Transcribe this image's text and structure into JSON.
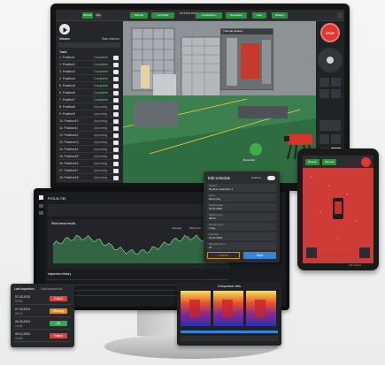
{
  "monitor": {
    "window_title": "ANYmal Monitor",
    "top_buttons": [
      "Mission",
      "Site",
      "Manual",
      "Controller",
      "Localization",
      "Navigation",
      "Map",
      "Battery"
    ],
    "mission_title": "Mission",
    "mission_subtitle": "Start mission",
    "tasks_header": "Tasks",
    "tasks": [
      {
        "name": "1. Position1",
        "status": "Completed"
      },
      {
        "name": "2. Position2",
        "status": "Completed"
      },
      {
        "name": "3. Position3",
        "status": "Completed"
      },
      {
        "name": "4. Position4",
        "status": "Completed"
      },
      {
        "name": "5. Position5",
        "status": "Completed"
      },
      {
        "name": "6. Position6",
        "status": "Completed"
      },
      {
        "name": "7. Position7",
        "status": "Completed"
      },
      {
        "name": "8. Position8",
        "status": "Upcoming"
      },
      {
        "name": "9. Position9",
        "status": "Upcoming"
      },
      {
        "name": "10. Position10",
        "status": "Upcoming"
      },
      {
        "name": "11. Position11",
        "status": "Upcoming"
      },
      {
        "name": "12. Position12",
        "status": "Upcoming"
      },
      {
        "name": "13. Position13",
        "status": "Upcoming"
      },
      {
        "name": "14. Position14",
        "status": "Upcoming"
      },
      {
        "name": "15. Position15",
        "status": "Upcoming"
      },
      {
        "name": "16. Position16",
        "status": "Upcoming"
      },
      {
        "name": "17. Position17",
        "status": "Upcoming"
      },
      {
        "name": "18. Position18",
        "status": "Upcoming"
      }
    ],
    "camera_label": "Thermal camera",
    "scene_label": "Recorded",
    "stop_label": "STOP"
  },
  "laptop": {
    "title": "PCS-N-735",
    "chart_title": "Wind trend results",
    "history_title": "Inspection history",
    "legend": [
      "Average",
      "Maximum",
      "Minimum"
    ]
  },
  "schedule": {
    "title": "Edit schedule",
    "toggle_label": "Enabled",
    "fields": [
      {
        "label": "Mission",
        "value": "Routine inspection 1"
      },
      {
        "label": "Name",
        "value": "Every day"
      },
      {
        "label": "Starting date",
        "value": "01.01.2024"
      },
      {
        "label": "Starting time",
        "value": "08:00"
      },
      {
        "label": "Repeat every",
        "value": "1 day"
      },
      {
        "label": "End date",
        "value": "01.01.2025"
      },
      {
        "label": "Estimated time",
        "value": "2h"
      }
    ],
    "cancel_label": "Cancel",
    "save_label": "Save"
  },
  "inspection": {
    "tabs": [
      "Last inspection",
      "Last inspections"
    ],
    "rows": [
      {
        "date": "07.03.2024",
        "time": "13:00",
        "badge": "Failed",
        "color": "#d64541"
      },
      {
        "date": "07.03.2024",
        "time": "09:12",
        "badge": "Warning",
        "color": "#e08a2c"
      },
      {
        "date": "06.03.2024",
        "time": "14:51",
        "badge": "OK",
        "color": "#3aa55a"
      },
      {
        "date": "06.11.2024",
        "time": "10:00",
        "badge": "Failed",
        "color": "#d64541"
      }
    ]
  },
  "compare": {
    "title": "Comparison view"
  },
  "tablet": {
    "top_buttons": [
      "Mission",
      "Manual"
    ],
    "bottom_label": "ANYbotics"
  },
  "colors": {
    "accent_green": "#2f8f3e",
    "stop_red": "#e2362f",
    "chart_green": "#3f9a5a"
  }
}
